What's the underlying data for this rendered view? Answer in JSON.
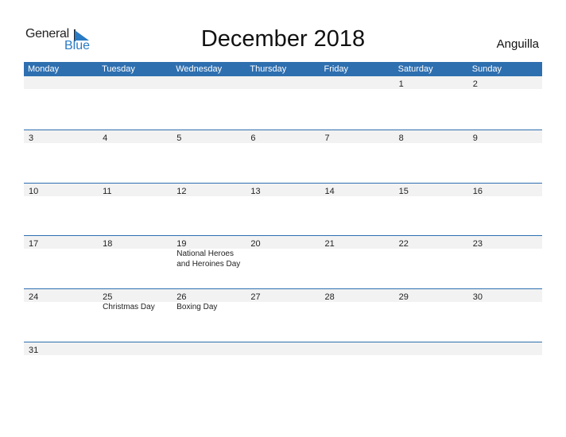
{
  "logo": {
    "part1": "General",
    "part2": "Blue"
  },
  "title": "December 2018",
  "country": "Anguilla",
  "weekdays": [
    "Monday",
    "Tuesday",
    "Wednesday",
    "Thursday",
    "Friday",
    "Saturday",
    "Sunday"
  ],
  "weeks": [
    [
      {
        "d": ""
      },
      {
        "d": ""
      },
      {
        "d": ""
      },
      {
        "d": ""
      },
      {
        "d": ""
      },
      {
        "d": "1"
      },
      {
        "d": "2"
      }
    ],
    [
      {
        "d": "3"
      },
      {
        "d": "4"
      },
      {
        "d": "5"
      },
      {
        "d": "6"
      },
      {
        "d": "7"
      },
      {
        "d": "8"
      },
      {
        "d": "9"
      }
    ],
    [
      {
        "d": "10"
      },
      {
        "d": "11"
      },
      {
        "d": "12"
      },
      {
        "d": "13"
      },
      {
        "d": "14"
      },
      {
        "d": "15"
      },
      {
        "d": "16"
      }
    ],
    [
      {
        "d": "17"
      },
      {
        "d": "18"
      },
      {
        "d": "19",
        "h": "National Heroes and Heroines Day"
      },
      {
        "d": "20"
      },
      {
        "d": "21"
      },
      {
        "d": "22"
      },
      {
        "d": "23"
      }
    ],
    [
      {
        "d": "24"
      },
      {
        "d": "25",
        "h": "Christmas Day"
      },
      {
        "d": "26",
        "h": "Boxing Day"
      },
      {
        "d": "27"
      },
      {
        "d": "28"
      },
      {
        "d": "29"
      },
      {
        "d": "30"
      }
    ],
    [
      {
        "d": "31"
      },
      {
        "d": ""
      },
      {
        "d": ""
      },
      {
        "d": ""
      },
      {
        "d": ""
      },
      {
        "d": ""
      },
      {
        "d": ""
      }
    ]
  ],
  "colors": {
    "accent": "#2e6fb0",
    "logo_blue": "#2a7bc4",
    "date_strip": "#f2f2f2"
  }
}
